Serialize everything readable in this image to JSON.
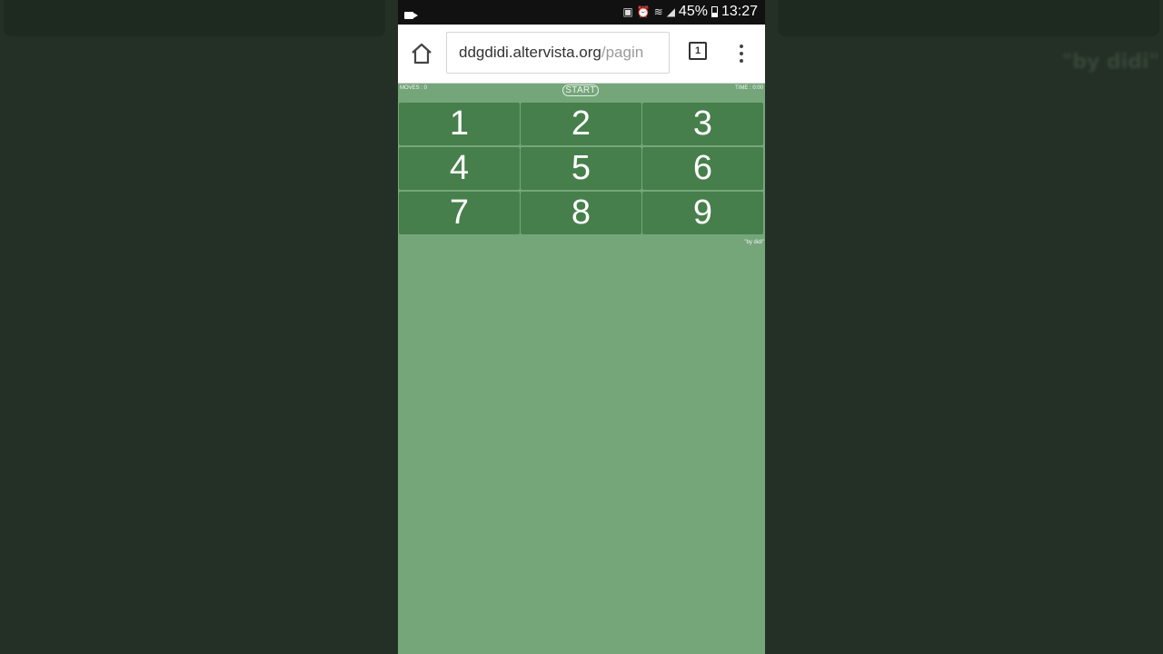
{
  "status_bar": {
    "battery": "45%",
    "clock": "13:27"
  },
  "browser": {
    "url_host": "ddgdidi.altervista.org",
    "url_path": "/pagin",
    "tab_count": "1"
  },
  "game": {
    "moves": "MOVES : 0",
    "time": "TIME : 0:00",
    "start_label": "START",
    "tiles": [
      "1",
      "2",
      "3",
      "4",
      "5",
      "6",
      "7",
      "8",
      "9"
    ],
    "credit": "\"by didi\""
  },
  "background": {
    "credit": "\"by didi\""
  },
  "colors": {
    "page_bg": "#75a67a",
    "tile_bg": "#467f4b",
    "status_bar_bg": "#111111",
    "outer_bg": "#253226"
  }
}
